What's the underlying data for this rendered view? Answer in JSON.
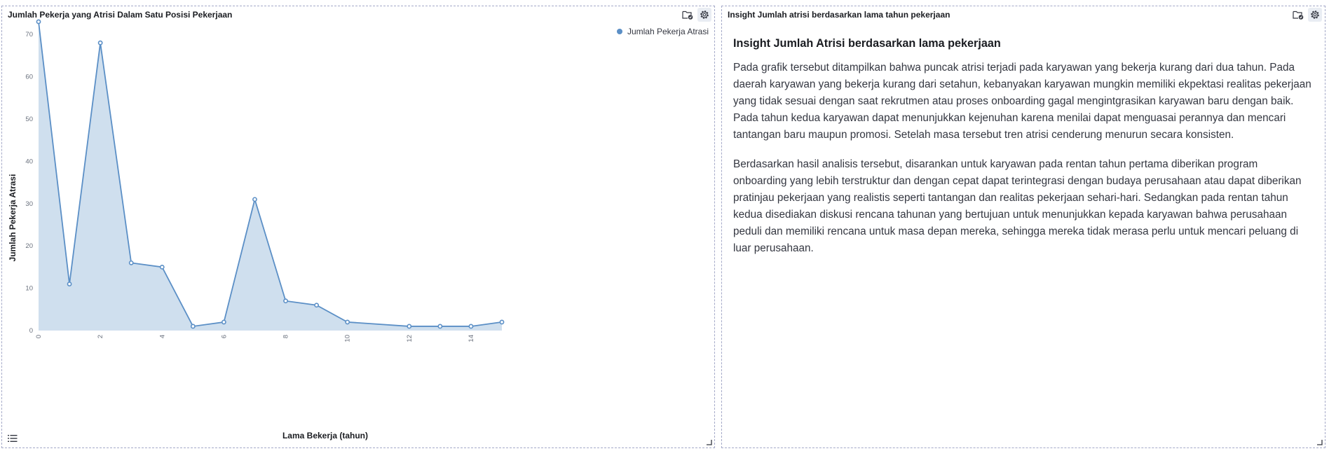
{
  "colors": {
    "series_line": "#5b8fc6",
    "series_fill": "#cfdfee",
    "axis_text": "#69707d",
    "grid": "#eef0f3"
  },
  "left_panel": {
    "title": "Jumlah Pekerja yang Atrisi Dalam Satu Posisi Pekerjaan",
    "actions": [
      "folder-check-icon",
      "gear-icon"
    ],
    "legend_label": "Jumlah Pekerja Atrasi"
  },
  "right_panel": {
    "title": "Insight Jumlah atrisi berdasarkan lama tahun pekerjaan",
    "actions": [
      "folder-check-icon",
      "gear-icon"
    ],
    "heading": "Insight Jumlah Atrisi berdasarkan lama pekerjaan",
    "paragraph1": "Pada grafik tersebut ditampilkan bahwa puncak atrisi terjadi pada karyawan yang bekerja kurang dari dua tahun. Pada daerah karyawan yang bekerja kurang dari setahun, kebanyakan karyawan mungkin memiliki ekpektasi realitas pekerjaan yang tidak sesuai dengan saat rekrutmen atau proses onboarding gagal mengintgrasikan karyawan baru dengan baik. Pada tahun kedua karyawan dapat menunjukkan kejenuhan karena menilai dapat menguasai perannya dan mencari tantangan baru maupun promosi. Setelah masa tersebut tren atrisi cenderung menurun secara konsisten.",
    "paragraph2": "Berdasarkan hasil analisis tersebut, disarankan untuk karyawan pada rentan tahun pertama diberikan program onboarding yang lebih terstruktur dan dengan cepat dapat terintegrasi dengan budaya perusahaan atau dapat diberikan pratinjau pekerjaan yang realistis seperti tantangan dan realitas pekerjaan sehari-hari. Sedangkan pada rentan tahun kedua disediakan diskusi rencana tahunan yang bertujuan untuk menunjukkan kepada karyawan bahwa perusahaan peduli dan memiliki rencana untuk masa depan mereka, sehingga mereka tidak merasa perlu untuk mencari peluang di luar perusahaan."
  },
  "chart_data": {
    "type": "area",
    "title": "Jumlah Pekerja yang Atrisi Dalam Satu Posisi Pekerjaan",
    "xlabel": "Lama Bekerja (tahun)",
    "ylabel": "Jumlah Pekerja Atrasi",
    "x": [
      0,
      1,
      2,
      3,
      4,
      5,
      6,
      7,
      8,
      9,
      10,
      12,
      13,
      14,
      15
    ],
    "series": [
      {
        "name": "Jumlah Pekerja Atrasi",
        "values": [
          73,
          11,
          68,
          16,
          15,
          1,
          2,
          31,
          7,
          6,
          2,
          1,
          1,
          1,
          2
        ]
      }
    ],
    "xlim": [
      0,
      15
    ],
    "ylim": [
      0,
      73
    ],
    "xticks": [
      "0",
      "2",
      "4",
      "6",
      "8",
      "10",
      "12",
      "14"
    ],
    "yticks": [
      "0",
      "10",
      "20",
      "30",
      "40",
      "50",
      "60",
      "70"
    ],
    "legend": "top-right",
    "grid": false
  }
}
